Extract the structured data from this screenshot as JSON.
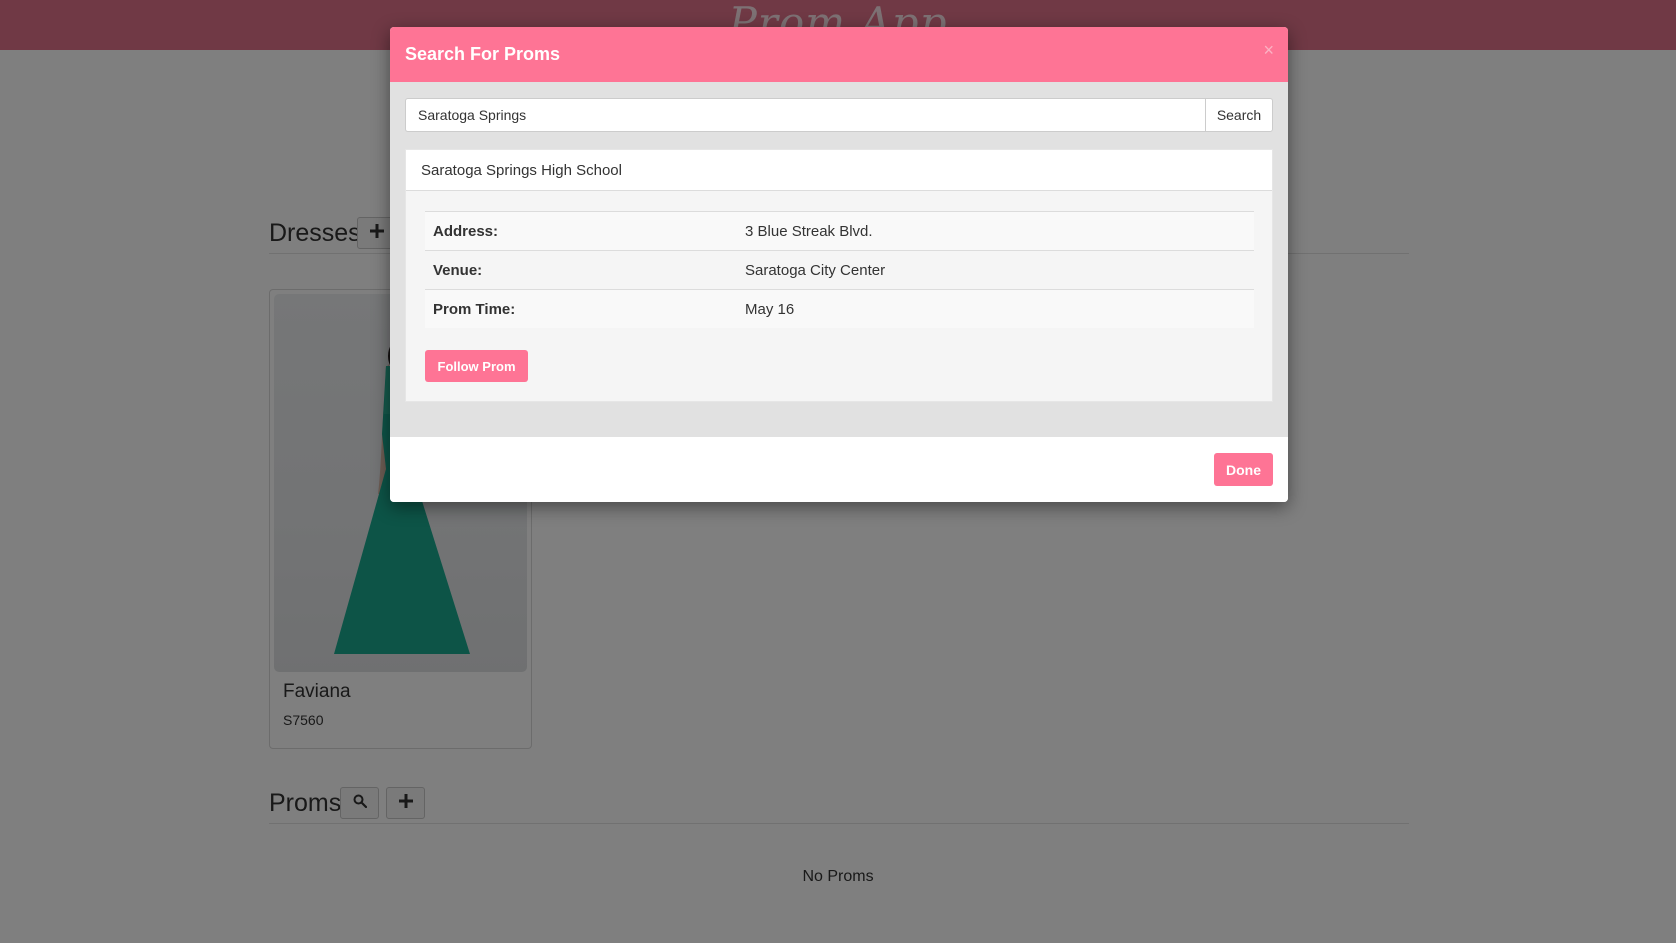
{
  "app": {
    "brand": "Prom App"
  },
  "dresses": {
    "title": "Dresses",
    "items": [
      {
        "name": "Faviana",
        "price": "S7560"
      }
    ]
  },
  "proms": {
    "title": "Proms",
    "empty_text": "No Proms"
  },
  "modal": {
    "title": "Search For Proms",
    "close_glyph": "×",
    "search": {
      "value": "Saratoga Springs",
      "placeholder": "",
      "button_label": "Search"
    },
    "result": {
      "name": "Saratoga Springs High School",
      "rows": [
        {
          "label": "Address:",
          "value": "3 Blue Streak Blvd."
        },
        {
          "label": "Venue:",
          "value": "Saratoga City Center"
        },
        {
          "label": "Prom Time:",
          "value": "May 16"
        }
      ],
      "follow_label": "Follow Prom"
    },
    "done_label": "Done"
  },
  "colors": {
    "accent": "#fe7495",
    "navbar": "#e0728a",
    "dress": "#1aa88e"
  }
}
